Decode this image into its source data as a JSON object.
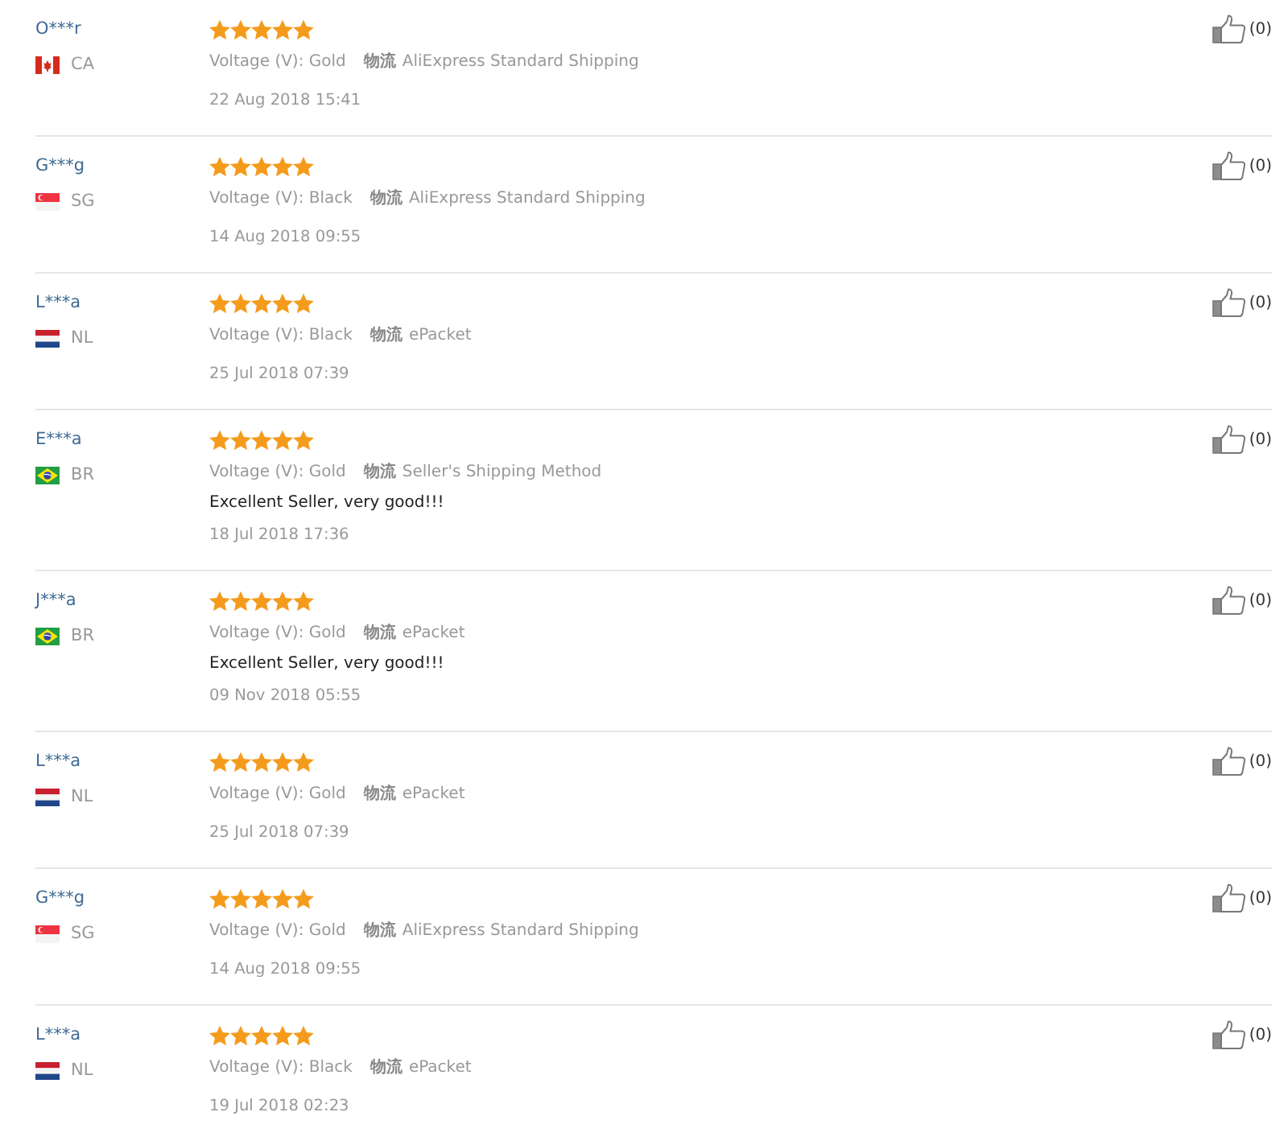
{
  "reviews": [
    {
      "name": "O***r",
      "country": "CA",
      "kind": "canada",
      "stars": 5,
      "variant": "Voltage (V): Gold",
      "shipping_label": "物流",
      "shipping": "AliExpress Standard Shipping",
      "date": "22 Aug 2018 15:41",
      "likes": "(0)"
    },
    {
      "name": "G***g",
      "country": "SG",
      "kind": "singapore",
      "stars": 5,
      "variant": "Voltage (V): Black",
      "shipping_label": "物流",
      "shipping": "AliExpress Standard Shipping",
      "date": "14 Aug 2018 09:55",
      "likes": "(0)"
    },
    {
      "name": "L***a",
      "country": "NL",
      "kind": "netherlands",
      "stars": 5,
      "variant": "Voltage (V): Black",
      "shipping_label": "物流",
      "shipping": "ePacket",
      "date": "25 Jul 2018 07:39",
      "likes": "(0)"
    },
    {
      "name": "E***a",
      "country": "BR",
      "kind": "brazil",
      "stars": 5,
      "variant": "Voltage (V): Gold",
      "shipping_label": "物流",
      "shipping": "Seller's Shipping Method",
      "comment": "Excellent Seller, very good!!!",
      "date": "18 Jul 2018 17:36",
      "likes": "(0)"
    },
    {
      "name": "J***a",
      "country": "BR",
      "kind": "brazil",
      "stars": 5,
      "variant": "Voltage (V): Gold",
      "shipping_label": "物流",
      "shipping": "ePacket",
      "comment": "Excellent Seller, very good!!!",
      "date": "09 Nov 2018 05:55",
      "likes": "(0)"
    },
    {
      "name": "L***a",
      "country": "NL",
      "kind": "netherlands",
      "stars": 5,
      "variant": "Voltage (V): Gold",
      "shipping_label": "物流",
      "shipping": "ePacket",
      "date": "25 Jul 2018 07:39",
      "likes": "(0)"
    },
    {
      "name": "G***g",
      "country": "SG",
      "kind": "singapore",
      "stars": 5,
      "variant": "Voltage (V): Gold",
      "shipping_label": "物流",
      "shipping": "AliExpress Standard Shipping",
      "date": "14 Aug 2018 09:55",
      "likes": "(0)"
    },
    {
      "name": "L***a",
      "country": "NL",
      "kind": "netherlands",
      "stars": 5,
      "variant": "Voltage (V): Black",
      "shipping_label": "物流",
      "shipping": "ePacket",
      "date": "19 Jul 2018 02:23",
      "likes": "(0)"
    }
  ]
}
